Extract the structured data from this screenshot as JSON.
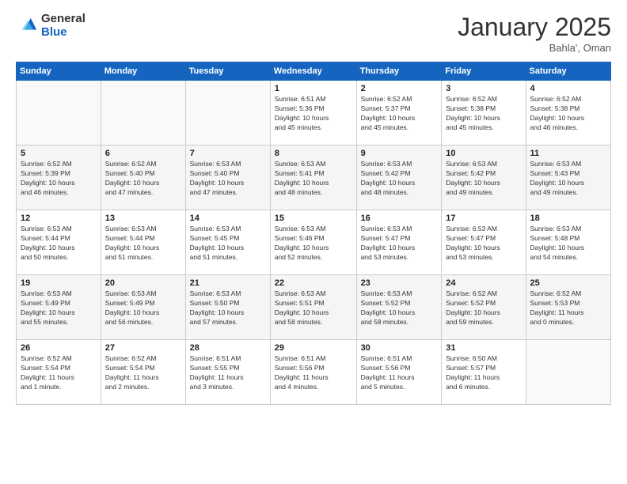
{
  "logo": {
    "general": "General",
    "blue": "Blue"
  },
  "header": {
    "month": "January 2025",
    "location": "Bahla', Oman"
  },
  "weekdays": [
    "Sunday",
    "Monday",
    "Tuesday",
    "Wednesday",
    "Thursday",
    "Friday",
    "Saturday"
  ],
  "weeks": [
    [
      {
        "day": "",
        "info": ""
      },
      {
        "day": "",
        "info": ""
      },
      {
        "day": "",
        "info": ""
      },
      {
        "day": "1",
        "info": "Sunrise: 6:51 AM\nSunset: 5:36 PM\nDaylight: 10 hours\nand 45 minutes."
      },
      {
        "day": "2",
        "info": "Sunrise: 6:52 AM\nSunset: 5:37 PM\nDaylight: 10 hours\nand 45 minutes."
      },
      {
        "day": "3",
        "info": "Sunrise: 6:52 AM\nSunset: 5:38 PM\nDaylight: 10 hours\nand 45 minutes."
      },
      {
        "day": "4",
        "info": "Sunrise: 6:52 AM\nSunset: 5:38 PM\nDaylight: 10 hours\nand 46 minutes."
      }
    ],
    [
      {
        "day": "5",
        "info": "Sunrise: 6:52 AM\nSunset: 5:39 PM\nDaylight: 10 hours\nand 46 minutes."
      },
      {
        "day": "6",
        "info": "Sunrise: 6:52 AM\nSunset: 5:40 PM\nDaylight: 10 hours\nand 47 minutes."
      },
      {
        "day": "7",
        "info": "Sunrise: 6:53 AM\nSunset: 5:40 PM\nDaylight: 10 hours\nand 47 minutes."
      },
      {
        "day": "8",
        "info": "Sunrise: 6:53 AM\nSunset: 5:41 PM\nDaylight: 10 hours\nand 48 minutes."
      },
      {
        "day": "9",
        "info": "Sunrise: 6:53 AM\nSunset: 5:42 PM\nDaylight: 10 hours\nand 48 minutes."
      },
      {
        "day": "10",
        "info": "Sunrise: 6:53 AM\nSunset: 5:42 PM\nDaylight: 10 hours\nand 49 minutes."
      },
      {
        "day": "11",
        "info": "Sunrise: 6:53 AM\nSunset: 5:43 PM\nDaylight: 10 hours\nand 49 minutes."
      }
    ],
    [
      {
        "day": "12",
        "info": "Sunrise: 6:53 AM\nSunset: 5:44 PM\nDaylight: 10 hours\nand 50 minutes."
      },
      {
        "day": "13",
        "info": "Sunrise: 6:53 AM\nSunset: 5:44 PM\nDaylight: 10 hours\nand 51 minutes."
      },
      {
        "day": "14",
        "info": "Sunrise: 6:53 AM\nSunset: 5:45 PM\nDaylight: 10 hours\nand 51 minutes."
      },
      {
        "day": "15",
        "info": "Sunrise: 6:53 AM\nSunset: 5:46 PM\nDaylight: 10 hours\nand 52 minutes."
      },
      {
        "day": "16",
        "info": "Sunrise: 6:53 AM\nSunset: 5:47 PM\nDaylight: 10 hours\nand 53 minutes."
      },
      {
        "day": "17",
        "info": "Sunrise: 6:53 AM\nSunset: 5:47 PM\nDaylight: 10 hours\nand 53 minutes."
      },
      {
        "day": "18",
        "info": "Sunrise: 6:53 AM\nSunset: 5:48 PM\nDaylight: 10 hours\nand 54 minutes."
      }
    ],
    [
      {
        "day": "19",
        "info": "Sunrise: 6:53 AM\nSunset: 5:49 PM\nDaylight: 10 hours\nand 55 minutes."
      },
      {
        "day": "20",
        "info": "Sunrise: 6:53 AM\nSunset: 5:49 PM\nDaylight: 10 hours\nand 56 minutes."
      },
      {
        "day": "21",
        "info": "Sunrise: 6:53 AM\nSunset: 5:50 PM\nDaylight: 10 hours\nand 57 minutes."
      },
      {
        "day": "22",
        "info": "Sunrise: 6:53 AM\nSunset: 5:51 PM\nDaylight: 10 hours\nand 58 minutes."
      },
      {
        "day": "23",
        "info": "Sunrise: 6:53 AM\nSunset: 5:52 PM\nDaylight: 10 hours\nand 58 minutes."
      },
      {
        "day": "24",
        "info": "Sunrise: 6:52 AM\nSunset: 5:52 PM\nDaylight: 10 hours\nand 59 minutes."
      },
      {
        "day": "25",
        "info": "Sunrise: 6:52 AM\nSunset: 5:53 PM\nDaylight: 11 hours\nand 0 minutes."
      }
    ],
    [
      {
        "day": "26",
        "info": "Sunrise: 6:52 AM\nSunset: 5:54 PM\nDaylight: 11 hours\nand 1 minute."
      },
      {
        "day": "27",
        "info": "Sunrise: 6:52 AM\nSunset: 5:54 PM\nDaylight: 11 hours\nand 2 minutes."
      },
      {
        "day": "28",
        "info": "Sunrise: 6:51 AM\nSunset: 5:55 PM\nDaylight: 11 hours\nand 3 minutes."
      },
      {
        "day": "29",
        "info": "Sunrise: 6:51 AM\nSunset: 5:56 PM\nDaylight: 11 hours\nand 4 minutes."
      },
      {
        "day": "30",
        "info": "Sunrise: 6:51 AM\nSunset: 5:56 PM\nDaylight: 11 hours\nand 5 minutes."
      },
      {
        "day": "31",
        "info": "Sunrise: 6:50 AM\nSunset: 5:57 PM\nDaylight: 11 hours\nand 6 minutes."
      },
      {
        "day": "",
        "info": ""
      }
    ]
  ]
}
